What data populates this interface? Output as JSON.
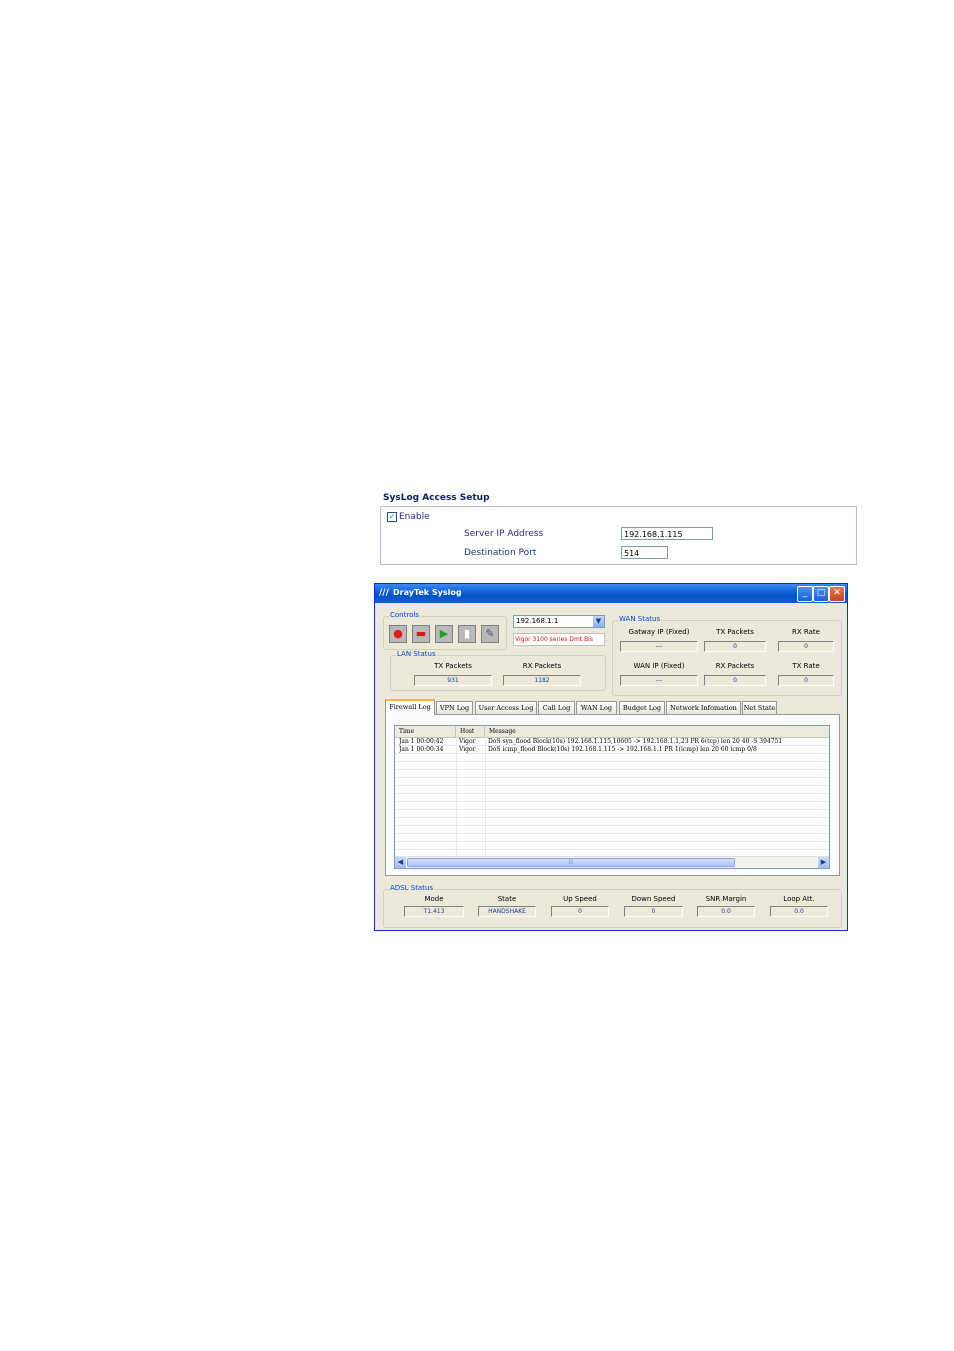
{
  "syslog_setup": {
    "title": "SysLog Access Setup",
    "enable_label": "Enable",
    "enable_checked": true,
    "server_ip_label": "Server IP Address",
    "server_ip_value": "192.168.1.115",
    "dest_port_label": "Destination Port",
    "dest_port_value": "514"
  },
  "window": {
    "title": "DrayTek Syslog",
    "controls_label": "Controls",
    "ip_select": "192.168.1.1",
    "model": "Vigor 3100   series Dmt.Bis",
    "lan_status": {
      "label": "LAN Status",
      "tx_label": "TX Packets",
      "tx_value": "931",
      "rx_label": "RX Packets",
      "rx_value": "1182"
    },
    "wan_status": {
      "label": "WAN Status",
      "gateway_label": "Gatway IP (Fixed)",
      "gateway_value": "---",
      "tx_label": "TX Packets",
      "tx_value": "0",
      "rxrate_label": "RX Rate",
      "rxrate_value": "0",
      "wanip_label": "WAN IP (Fixed)",
      "wanip_value": "---",
      "rx_label": "RX Packets",
      "rx_value": "0",
      "txrate_label": "TX Rate",
      "txrate_value": "0"
    },
    "tabs": [
      "Firewall Log",
      "VPN Log",
      "User Access Log",
      "Call Log",
      "WAN Log",
      "Budget Log",
      "Network Infomation",
      "Net State"
    ],
    "log_columns": [
      "Time",
      "Host",
      "Message"
    ],
    "log_rows": [
      [
        "Jan  1 00:00:42",
        "Vigor",
        "DoS syn_flood Block(10s) 192.168.1.115,10605 -> 192.168.1.1,23 PR 6(tcp) len 20 40 -S 394751"
      ],
      [
        "Jan  1 00:00:34",
        "Vigor",
        "DoS icmp_flood Block(10s) 192.168.1.115 -> 192.168.1.1 PR 1(icmp) len 20 60 icmp 0/8"
      ]
    ],
    "adsl_status": {
      "label": "ADSL Status",
      "mode_label": "Mode",
      "mode_value": "T1.413",
      "state_label": "State",
      "state_value": "HANDSHAKE",
      "up_label": "Up Speed",
      "up_value": "0",
      "down_label": "Down Speed",
      "down_value": "0",
      "snr_label": "SNR Margin",
      "snr_value": "0.0",
      "loop_label": "Loop Att.",
      "loop_value": "0.0"
    }
  }
}
